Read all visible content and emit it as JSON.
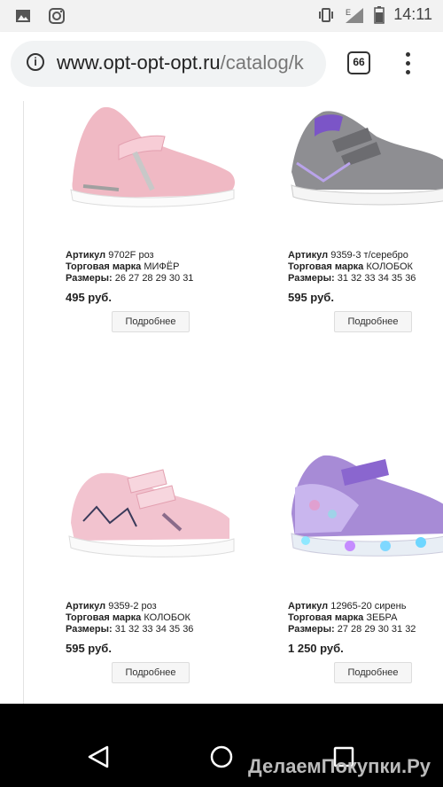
{
  "status_bar": {
    "time": "14:11",
    "left_icons": [
      "image-icon",
      "instagram-icon"
    ],
    "right_icons": [
      "vibrate-icon",
      "signal-icon",
      "battery-icon"
    ],
    "network_label": "E"
  },
  "browser": {
    "url_domain": "www.opt-opt-opt.ru",
    "url_rest": "/catalog/k",
    "tab_count": "66"
  },
  "products": [
    {
      "sku_label": "Артикул",
      "sku": "9702F роз",
      "brand_label": "Торговая марка",
      "brand": "МИФЁР",
      "sizes_label": "Размеры:",
      "sizes": "26 27 28 29 30 31",
      "price": "495 руб.",
      "button": "Подробнее"
    },
    {
      "sku_label": "Артикул",
      "sku": "9359-3 т/серебро",
      "brand_label": "Торговая марка",
      "brand": "КОЛОБОК",
      "sizes_label": "Размеры:",
      "sizes": "31 32 33 34 35 36",
      "price": "595 руб.",
      "button": "Подробнее"
    },
    {
      "sku_label": "Артикул",
      "sku": "9359-2 роз",
      "brand_label": "Торговая марка",
      "brand": "КОЛОБОК",
      "sizes_label": "Размеры:",
      "sizes": "31 32 33 34 35 36",
      "price": "595 руб.",
      "button": "Подробнее"
    },
    {
      "sku_label": "Артикул",
      "sku": "12965-20 сирень",
      "brand_label": "Торговая марка",
      "brand": "ЗЕБРА",
      "sizes_label": "Размеры:",
      "sizes": "27 28 29 30 31 32",
      "price": "1 250 руб.",
      "button": "Подробнее"
    }
  ],
  "nav_bar": {
    "icons": [
      "back-icon",
      "home-icon",
      "recents-icon"
    ]
  },
  "watermark": "ДелаемПокупки.Ру"
}
